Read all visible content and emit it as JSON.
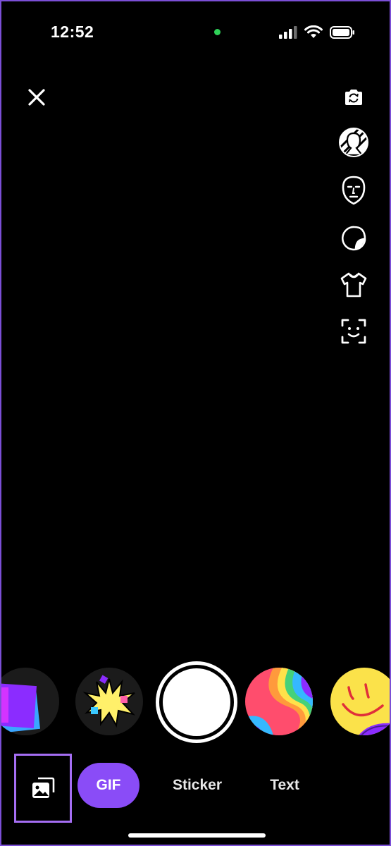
{
  "status_bar": {
    "time": "12:52"
  },
  "icons": {
    "close": "close-icon",
    "flip_camera": "flip-camera-icon",
    "avatar": "avatar-icon",
    "face_mask": "face-mask-icon",
    "sticker": "sticker-icon",
    "outfit": "tshirt-icon",
    "face_scan": "face-scan-icon",
    "gallery": "gallery-icon"
  },
  "modes": [
    {
      "label": "GIF",
      "selected": true
    },
    {
      "label": "Sticker",
      "selected": false
    },
    {
      "label": "Text",
      "selected": false
    }
  ],
  "colors": {
    "accent": "#8a4cf7",
    "highlight_border": "#a56ef3"
  }
}
